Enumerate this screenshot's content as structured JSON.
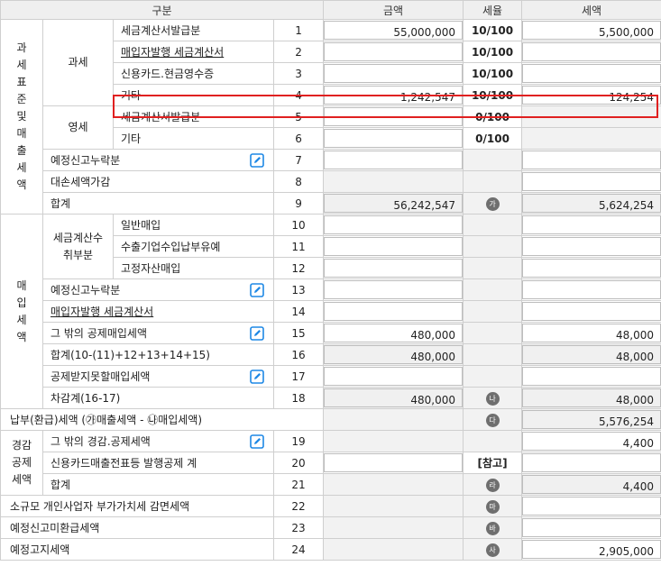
{
  "header": {
    "category": "구분",
    "amount": "금액",
    "tax_rate": "세율",
    "tax": "세액"
  },
  "groups": {
    "standard": "과세표준및매출세액",
    "taxable": "과세",
    "zero": "영세",
    "purchase": "매입세액",
    "invoice_recv": "세금계산수취부분",
    "reduction": "경감공제세액"
  },
  "rows": [
    {
      "label": "세금계산서발급분",
      "no": "1",
      "amount": "55,000,000",
      "rate": "10/100",
      "tax": "5,500,000"
    },
    {
      "label": "매입자발행 세금계산서",
      "no": "2",
      "amount": "",
      "rate": "10/100",
      "tax": ""
    },
    {
      "label": "신용카드.현금영수증",
      "no": "3",
      "amount": "",
      "rate": "10/100",
      "tax": ""
    },
    {
      "label": "기타",
      "no": "4",
      "amount": "1,242,547",
      "rate": "10/100",
      "tax": "124,254"
    },
    {
      "label": "세금계산서발급분",
      "no": "5",
      "amount": "",
      "rate": "0/100",
      "tax": ""
    },
    {
      "label": "기타",
      "no": "6",
      "amount": "",
      "rate": "0/100",
      "tax": ""
    },
    {
      "label": "예정신고누락분",
      "no": "7",
      "amount": "",
      "rate": "",
      "tax": ""
    },
    {
      "label": "대손세액가감",
      "no": "8",
      "amount": "",
      "rate": "",
      "tax": ""
    },
    {
      "label": "합계",
      "no": "9",
      "amount": "56,242,547",
      "rate": "가",
      "tax": "5,624,254"
    },
    {
      "label": "일반매입",
      "no": "10",
      "amount": "",
      "rate": "",
      "tax": ""
    },
    {
      "label": "수출기업수입납부유예",
      "no": "11",
      "amount": "",
      "rate": "",
      "tax": ""
    },
    {
      "label": "고정자산매입",
      "no": "12",
      "amount": "",
      "rate": "",
      "tax": ""
    },
    {
      "label": "예정신고누락분",
      "no": "13",
      "amount": "",
      "rate": "",
      "tax": ""
    },
    {
      "label": "매입자발행 세금계산서",
      "no": "14",
      "amount": "",
      "rate": "",
      "tax": ""
    },
    {
      "label": "그 밖의 공제매입세액",
      "no": "15",
      "amount": "480,000",
      "rate": "",
      "tax": "48,000"
    },
    {
      "label": "합계(10-(11)+12+13+14+15)",
      "no": "16",
      "amount": "480,000",
      "rate": "",
      "tax": "48,000"
    },
    {
      "label": "공제받지못할매입세액",
      "no": "17",
      "amount": "",
      "rate": "",
      "tax": ""
    },
    {
      "label": "차감계(16-17)",
      "no": "18",
      "amount": "480,000",
      "rate": "나",
      "tax": "48,000"
    },
    {
      "label": "납부(환급)세액 (㉮매출세액 - ㉯매입세액)",
      "no": "",
      "amount": "",
      "rate": "다",
      "tax": "5,576,254"
    },
    {
      "label": "그 밖의 경감.공제세액",
      "no": "19",
      "amount": "",
      "rate": "",
      "tax": "4,400"
    },
    {
      "label": "신용카드매출전표등 발행공제 계",
      "no": "20",
      "amount": "",
      "rate": "[참고]",
      "tax": ""
    },
    {
      "label": "합계",
      "no": "21",
      "amount": "",
      "rate": "라",
      "tax": "4,400"
    },
    {
      "label": "소규모 개인사업자 부가가치세 감면세액",
      "no": "22",
      "amount": "",
      "rate": "마",
      "tax": ""
    },
    {
      "label": "예정신고미환급세액",
      "no": "23",
      "amount": "",
      "rate": "바",
      "tax": ""
    },
    {
      "label": "예정고지세액",
      "no": "24",
      "amount": "",
      "rate": "사",
      "tax": "2,905,000"
    }
  ],
  "icons": {
    "edit": "edit-pencil-icon",
    "marker": "circled-hangul-icon"
  },
  "colors": {
    "highlight": "#e02020",
    "edit_icon": "#1e88e5",
    "header_bg": "#efefef",
    "disabled_bg": "#f2f2f2"
  }
}
